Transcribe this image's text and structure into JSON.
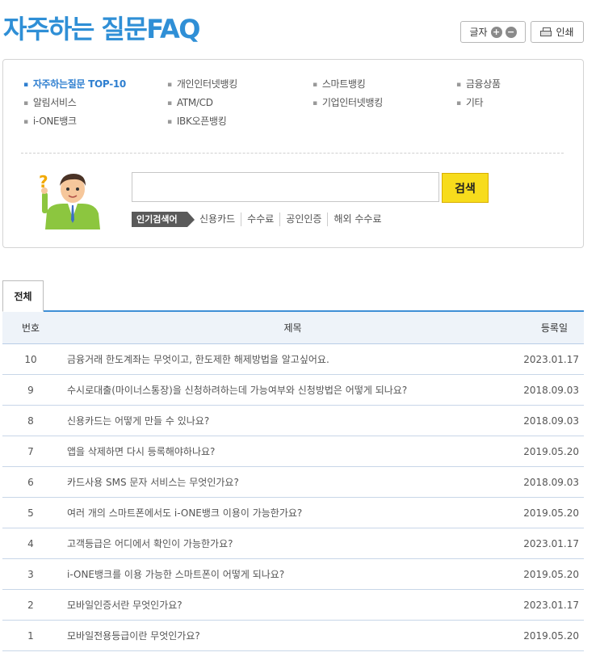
{
  "header": {
    "title": "자주하는 질문FAQ",
    "font_label": "글자",
    "font_plus": "+",
    "font_minus": "−",
    "print_label": "인쇄"
  },
  "categories": [
    {
      "label": "자주하는질문 TOP-10",
      "active": true
    },
    {
      "label": "개인인터넷뱅킹"
    },
    {
      "label": "스마트뱅킹"
    },
    {
      "label": "금융상품"
    },
    {
      "label": "알림서비스"
    },
    {
      "label": "ATM/CD"
    },
    {
      "label": "기업인터넷뱅킹"
    },
    {
      "label": "기타"
    },
    {
      "label": "i-ONE뱅크"
    },
    {
      "label": "IBK오픈뱅킹"
    }
  ],
  "search": {
    "value": "",
    "button_label": "검색",
    "popular_label": "인기검색어",
    "popular_keywords": [
      "신용카드",
      "수수료",
      "공인인증",
      "해외 수수료"
    ]
  },
  "tabs": [
    {
      "label": "전체",
      "active": true
    }
  ],
  "table": {
    "headers": {
      "num": "번호",
      "title": "제목",
      "date": "등록일"
    },
    "rows": [
      {
        "num": "10",
        "title": "금융거래 한도계좌는 무엇이고, 한도제한 해제방법을 알고싶어요.",
        "date": "2023.01.17"
      },
      {
        "num": "9",
        "title": "수시로대출(마이너스통장)을 신청하려하는데 가능여부와 신청방법은 어떻게 되나요?",
        "date": "2018.09.03"
      },
      {
        "num": "8",
        "title": "신용카드는 어떻게 만들 수 있나요?",
        "date": "2018.09.03"
      },
      {
        "num": "7",
        "title": "앱을 삭제하면 다시 등록해야하나요?",
        "date": "2019.05.20"
      },
      {
        "num": "6",
        "title": "카드사용 SMS 문자 서비스는 무엇인가요?",
        "date": "2018.09.03"
      },
      {
        "num": "5",
        "title": "여러 개의 스마트폰에서도 i-ONE뱅크 이용이 가능한가요?",
        "date": "2019.05.20"
      },
      {
        "num": "4",
        "title": "고객등급은 어디에서 확인이 가능한가요?",
        "date": "2023.01.17"
      },
      {
        "num": "3",
        "title": "i-ONE뱅크를 이용 가능한 스마트폰이 어떻게 되나요?",
        "date": "2019.05.20"
      },
      {
        "num": "2",
        "title": "모바일인증서란 무엇인가요?",
        "date": "2023.01.17"
      },
      {
        "num": "1",
        "title": "모바일전용등급이란 무엇인가요?",
        "date": "2019.05.20"
      }
    ]
  },
  "colors": {
    "title_blue": "#2f8fd6",
    "active_category": "#2f7fd0",
    "search_button": "#f7dc1c",
    "table_header_bg": "#eef3f9",
    "tab_line": "#3f8fd6"
  }
}
